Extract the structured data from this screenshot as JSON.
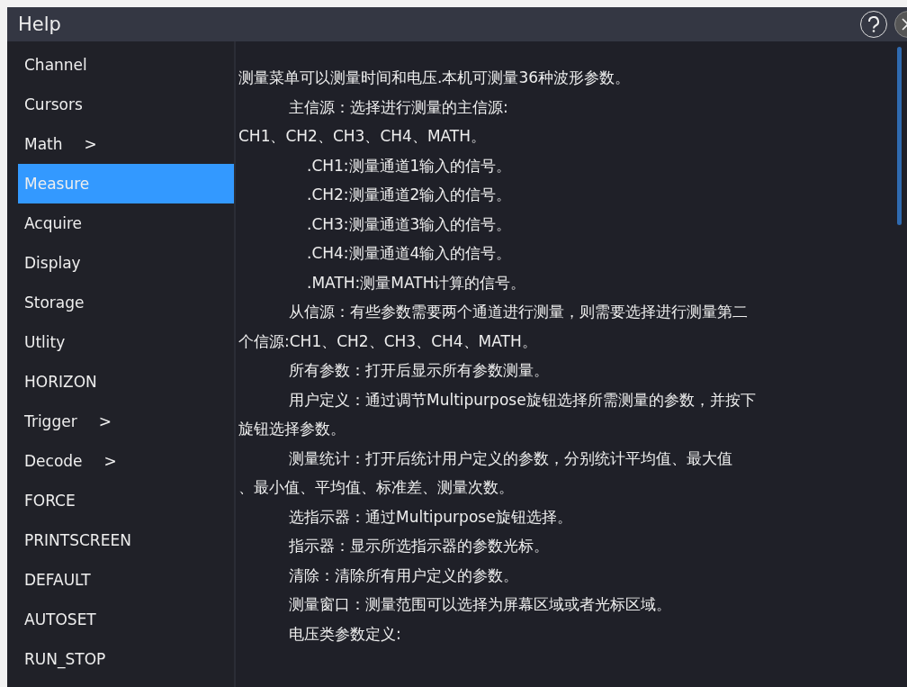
{
  "window": {
    "title": "Help"
  },
  "sidebar": {
    "items": [
      {
        "label": "Channel",
        "selected": false
      },
      {
        "label": "Cursors",
        "selected": false
      },
      {
        "label": "Math",
        "arrow": ">",
        "selected": false
      },
      {
        "label": "Measure",
        "selected": true
      },
      {
        "label": "Acquire",
        "selected": false
      },
      {
        "label": "Display",
        "selected": false
      },
      {
        "label": "Storage",
        "selected": false
      },
      {
        "label": "Utlity",
        "selected": false
      },
      {
        "label": "HORIZON",
        "selected": false
      },
      {
        "label": "Trigger",
        "arrow": ">",
        "selected": false
      },
      {
        "label": "Decode",
        "arrow": ">",
        "selected": false
      },
      {
        "label": "FORCE",
        "selected": false
      },
      {
        "label": "PRINTSCREEN",
        "selected": false
      },
      {
        "label": "DEFAULT",
        "selected": false
      },
      {
        "label": "AUTOSET",
        "selected": false
      },
      {
        "label": "RUN_STOP",
        "selected": false
      }
    ]
  },
  "content": {
    "lines": [
      {
        "kind": "plain",
        "text": "测量菜单可以测量时间和电压.本机可测量36种波形参数。"
      },
      {
        "kind": "indent",
        "text": "主信源：选择进行测量的主信源:"
      },
      {
        "kind": "plain",
        "text": "CH1、CH2、CH3、CH4、MATH。"
      },
      {
        "kind": "deep",
        "text": ".CH1:测量通道1输入的信号。"
      },
      {
        "kind": "deep",
        "text": ".CH2:测量通道2输入的信号。"
      },
      {
        "kind": "deep",
        "text": ".CH3:测量通道3输入的信号。"
      },
      {
        "kind": "deep",
        "text": ".CH4:测量通道4输入的信号。"
      },
      {
        "kind": "deep",
        "text": ".MATH:测量MATH计算的信号。"
      },
      {
        "kind": "indent",
        "text": "从信源：有些参数需要两个通道进行测量，则需要选择进行测量第二"
      },
      {
        "kind": "plain",
        "text": "个信源:CH1、CH2、CH3、CH4、MATH。"
      },
      {
        "kind": "indent",
        "text": "所有参数：打开后显示所有参数测量。"
      },
      {
        "kind": "indent",
        "text": "用户定义：通过调节Multipurpose旋钮选择所需测量的参数，并按下"
      },
      {
        "kind": "plain",
        "text": "旋钮选择参数。"
      },
      {
        "kind": "indent",
        "text": "测量统计：打开后统计用户定义的参数，分别统计平均值、最大值"
      },
      {
        "kind": "plain",
        "text": "、最小值、平均值、标准差、测量次数。"
      },
      {
        "kind": "indent",
        "text": "选指示器：通过Multipurpose旋钮选择。"
      },
      {
        "kind": "indent",
        "text": "指示器：显示所选指示器的参数光标。"
      },
      {
        "kind": "indent",
        "text": "清除：清除所有用户定义的参数。"
      },
      {
        "kind": "indent",
        "text": "测量窗口：测量范围可以选择为屏幕区域或者光标区域。"
      },
      {
        "kind": "indent",
        "text": "电压类参数定义:"
      }
    ]
  }
}
